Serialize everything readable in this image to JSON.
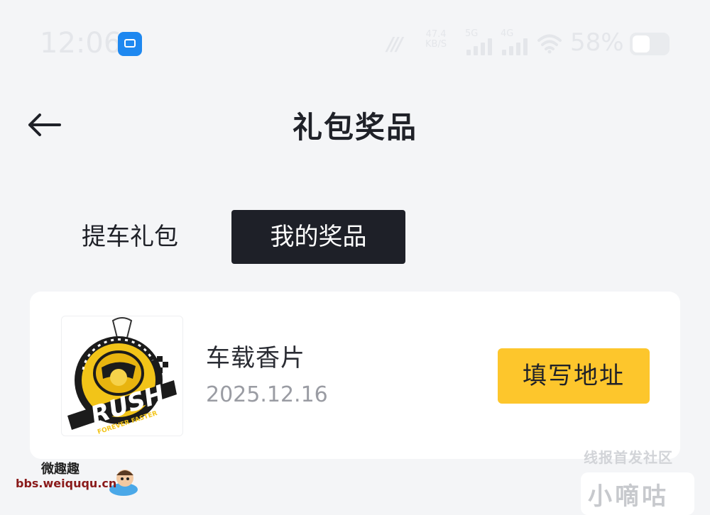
{
  "status_bar": {
    "time": "12:06",
    "net_speed_value": "47.4",
    "net_speed_unit": "KB/S",
    "signal_5g": "5G",
    "signal_4g": "4G",
    "battery_percent": "58%"
  },
  "header": {
    "back_icon": "arrow-left-icon",
    "title": "礼包奖品"
  },
  "tabs": [
    {
      "label": "提车礼包",
      "active": false
    },
    {
      "label": "我的奖品",
      "active": true
    }
  ],
  "prizes": [
    {
      "name": "车载香片",
      "date": "2025.12.16",
      "image": {
        "brand_text": "RUSH",
        "tagline": "FOREVER FASTER"
      },
      "action_label": "填写地址"
    }
  ],
  "watermarks": {
    "left_title": "微趣趣",
    "left_url": "bbs.weiququ.cn",
    "right_text": "线报首发社区",
    "right_label": "小嘀咕"
  },
  "colors": {
    "background": "#f4f5f7",
    "active_tab": "#1e2028",
    "accent_button": "#fdc62c",
    "date_text": "#9a9ca3"
  }
}
